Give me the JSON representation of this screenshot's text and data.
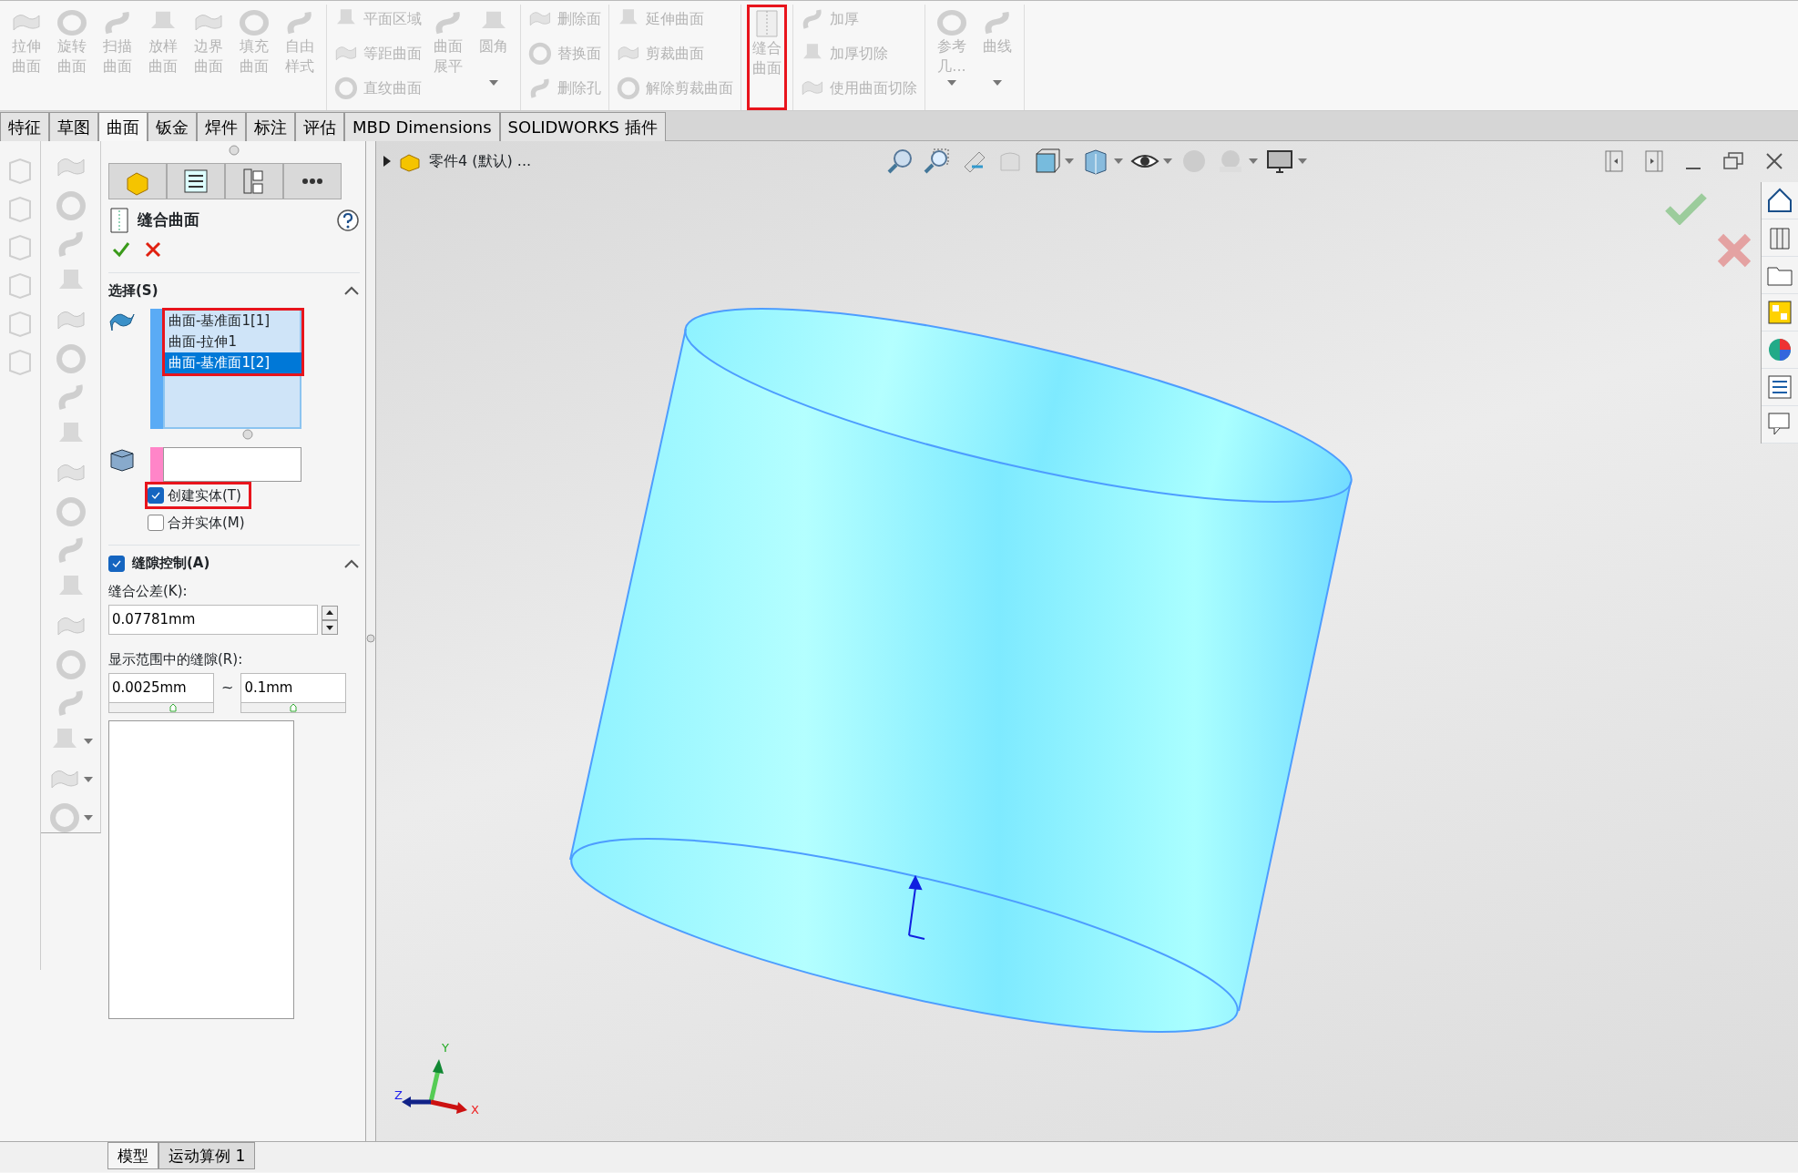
{
  "ribbon": {
    "groups": [
      {
        "columns": [
          {
            "kind": "large",
            "button": {
              "lines": [
                "拉伸",
                "曲面"
              ],
              "disabled": true,
              "highlighted": false,
              "menu": false
            }
          },
          {
            "kind": "large",
            "button": {
              "lines": [
                "旋转",
                "曲面"
              ],
              "disabled": true,
              "highlighted": false,
              "menu": false
            }
          },
          {
            "kind": "large",
            "button": {
              "lines": [
                "扫描",
                "曲面"
              ],
              "disabled": true,
              "highlighted": false,
              "menu": false
            }
          },
          {
            "kind": "large",
            "button": {
              "lines": [
                "放样",
                "曲面"
              ],
              "disabled": true,
              "highlighted": false,
              "menu": false
            }
          },
          {
            "kind": "large",
            "button": {
              "lines": [
                "边界",
                "曲面"
              ],
              "disabled": true,
              "highlighted": false,
              "menu": false
            }
          },
          {
            "kind": "large",
            "button": {
              "lines": [
                "填充",
                "曲面"
              ],
              "disabled": true,
              "highlighted": false,
              "menu": false
            }
          },
          {
            "kind": "large",
            "button": {
              "lines": [
                "自由",
                "样式"
              ],
              "disabled": true,
              "highlighted": false,
              "menu": false
            }
          }
        ]
      },
      {
        "columns": [
          {
            "kind": "small",
            "buttons": [
              {
                "label": "平面区域",
                "disabled": true
              },
              {
                "label": "等距曲面",
                "disabled": true
              },
              {
                "label": "直纹曲面",
                "disabled": true
              }
            ]
          },
          {
            "kind": "large",
            "button": {
              "lines": [
                "曲面",
                "展平"
              ],
              "disabled": true,
              "highlighted": false,
              "menu": false
            }
          },
          {
            "kind": "large",
            "button": {
              "lines": [
                "圆角"
              ],
              "disabled": true,
              "highlighted": false,
              "menu": true
            }
          }
        ]
      },
      {
        "columns": [
          {
            "kind": "small",
            "buttons": [
              {
                "label": "删除面",
                "disabled": true
              },
              {
                "label": "替换面",
                "disabled": true
              },
              {
                "label": "删除孔",
                "disabled": true
              }
            ]
          }
        ]
      },
      {
        "columns": [
          {
            "kind": "small",
            "buttons": [
              {
                "label": "延伸曲面",
                "disabled": true
              },
              {
                "label": "剪裁曲面",
                "disabled": true
              },
              {
                "label": "解除剪裁曲面",
                "disabled": true
              }
            ]
          }
        ]
      },
      {
        "columns": [
          {
            "kind": "large",
            "button": {
              "lines": [
                "缝合",
                "曲面"
              ],
              "disabled": true,
              "highlighted": true,
              "menu": false
            }
          }
        ]
      },
      {
        "columns": [
          {
            "kind": "small",
            "buttons": [
              {
                "label": "加厚",
                "disabled": true
              },
              {
                "label": "加厚切除",
                "disabled": true
              },
              {
                "label": "使用曲面切除",
                "disabled": true
              }
            ]
          }
        ]
      },
      {
        "columns": [
          {
            "kind": "large",
            "button": {
              "lines": [
                "参考",
                "几..."
              ],
              "disabled": true,
              "highlighted": false,
              "menu": true
            }
          },
          {
            "kind": "large",
            "button": {
              "lines": [
                "曲线"
              ],
              "disabled": true,
              "highlighted": false,
              "menu": true
            }
          }
        ]
      }
    ]
  },
  "command_tabs": [
    {
      "label": "特征",
      "selected": false
    },
    {
      "label": "草图",
      "selected": false
    },
    {
      "label": "曲面",
      "selected": true
    },
    {
      "label": "钣金",
      "selected": false
    },
    {
      "label": "焊件",
      "selected": false
    },
    {
      "label": "标注",
      "selected": false
    },
    {
      "label": "评估",
      "selected": false
    },
    {
      "label": "MBD Dimensions",
      "selected": false
    },
    {
      "label": "SOLIDWORKS 插件",
      "selected": false
    }
  ],
  "tree": {
    "label": "零件4 (默认) ..."
  },
  "property_manager": {
    "title": "缝合曲面",
    "selection": {
      "heading": "选择(S)",
      "expanded": true,
      "highlighted": true,
      "items": [
        {
          "label": "曲面-基准面1[1]",
          "selected": false
        },
        {
          "label": "曲面-拉伸1",
          "selected": false
        },
        {
          "label": "曲面-基准面1[2]",
          "selected": true
        }
      ]
    },
    "options": [
      {
        "label": "创建实体(T)",
        "checked": true,
        "highlighted": true
      },
      {
        "label": "合并实体(M)",
        "checked": false,
        "highlighted": false
      }
    ],
    "gap_control": {
      "heading": "缝隙控制(A)",
      "checked": true,
      "expanded": true,
      "tolerance_label": "缝合公差(K):",
      "tolerance_value": "0.07781mm",
      "range_label": "显示范围中的缝隙(R):",
      "range_min": {
        "value": "0.0025mm",
        "level": 0.61
      },
      "separator": "~",
      "range_max": {
        "value": "0.1mm",
        "level": 0.5
      }
    }
  },
  "triad": {
    "x": "X",
    "y": "Y",
    "z": "Z"
  },
  "bottom_tabs": [
    {
      "label": "模型",
      "selected": true
    },
    {
      "label": "运动算例 1",
      "selected": false
    }
  ]
}
